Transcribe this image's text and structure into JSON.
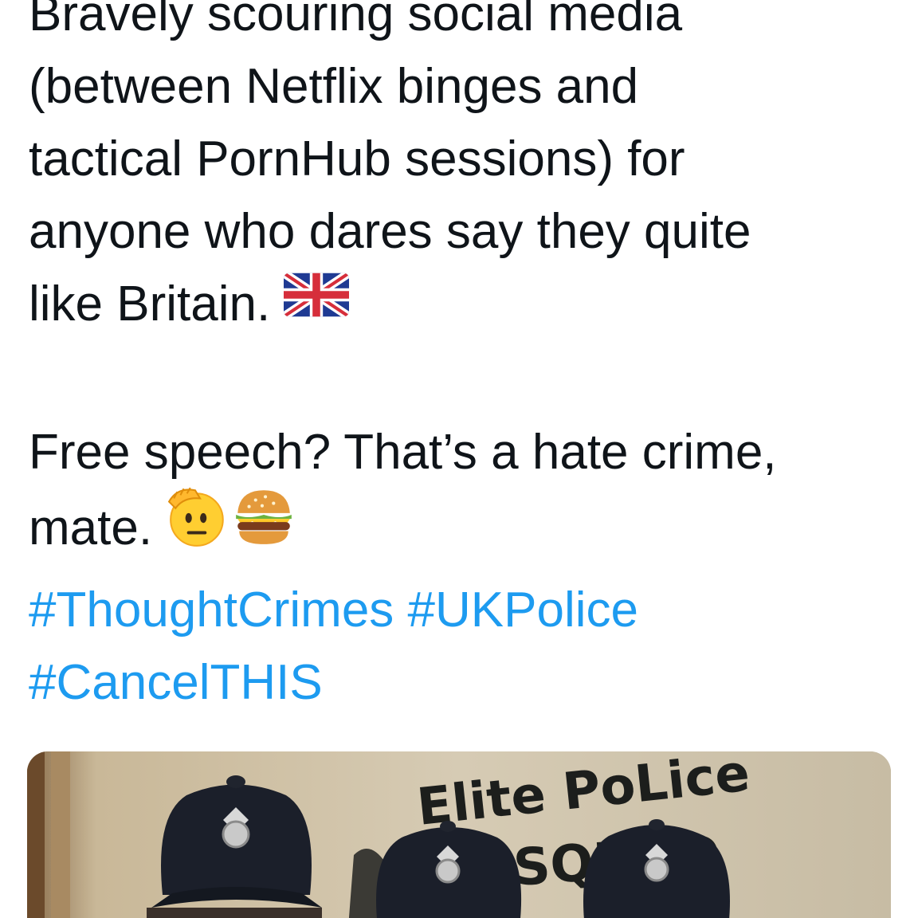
{
  "tweet": {
    "lines": [
      "Bravely scouring social media",
      "(between Netflix binges and",
      "tactical PornHub sessions) for",
      "anyone who dares say they quite",
      "like Britain."
    ],
    "line_2_a": "Free speech? That’s a hate crime,",
    "line_2_b": "mate.",
    "hashtags": [
      "#ThoughtCrimes",
      "#UKPolice",
      "#CancelTHIS"
    ],
    "emojis": [
      "uk-flag",
      "saluting-face",
      "hamburger"
    ]
  },
  "media": {
    "graffiti_line_1": "Elite PoLice",
    "graffiti_line_2": "SQUOD"
  }
}
